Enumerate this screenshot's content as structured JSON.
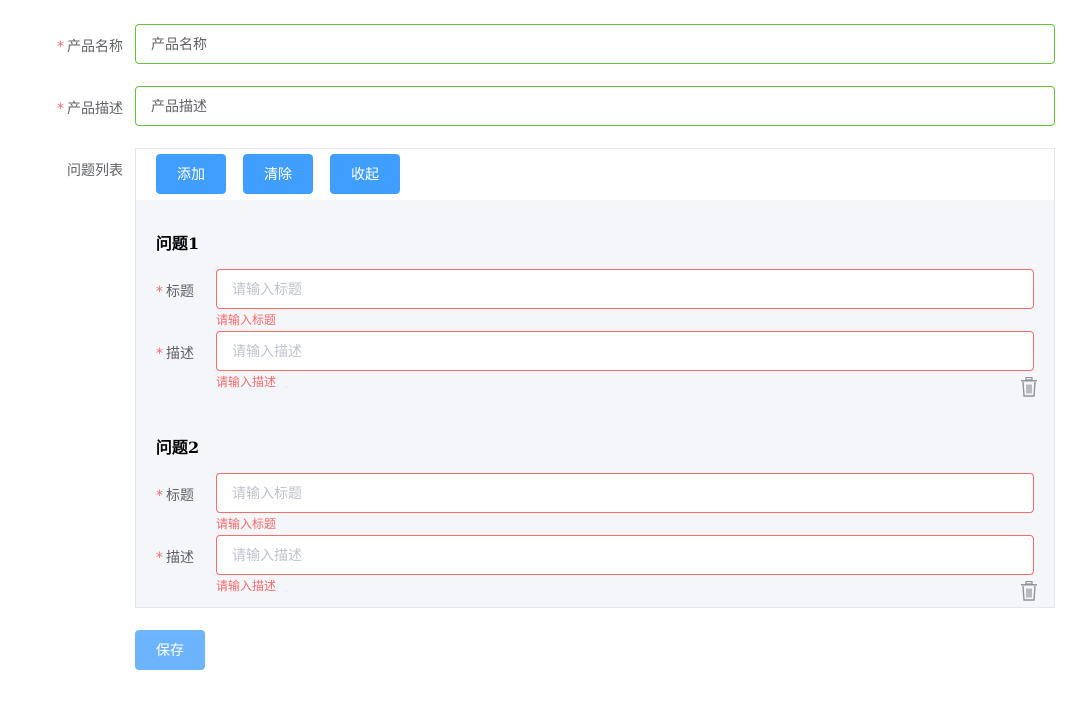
{
  "form": {
    "product_name": {
      "label": "产品名称",
      "value": "产品名称",
      "required": true
    },
    "product_desc": {
      "label": "产品描述",
      "value": "产品描述",
      "required": true
    },
    "question_list_label": "问题列表",
    "toolbar": {
      "add_label": "添加",
      "clear_label": "清除",
      "collapse_label": "收起"
    },
    "questions": [
      {
        "title": "问题1",
        "title_field": {
          "label": "标题",
          "placeholder": "请输入标题",
          "error": "请输入标题"
        },
        "desc_field": {
          "label": "描述",
          "placeholder": "请输入描述",
          "error": "请输入描述"
        },
        "delete_icon": "trash-icon"
      },
      {
        "title": "问题2",
        "title_field": {
          "label": "标题",
          "placeholder": "请输入标题",
          "error": "请输入标题"
        },
        "desc_field": {
          "label": "描述",
          "placeholder": "请输入描述",
          "error": "请输入描述"
        },
        "delete_icon": "trash-icon"
      }
    ],
    "save_label": "保存"
  },
  "colors": {
    "primary": "#409eff",
    "success_border": "#67c23a",
    "error": "#f56c6c",
    "panel_bg": "#f5f6f9"
  }
}
